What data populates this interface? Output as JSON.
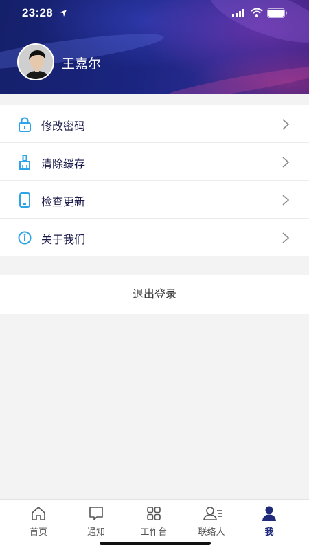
{
  "status_bar": {
    "time": "23:28"
  },
  "profile": {
    "name": "王嘉尔"
  },
  "menu": {
    "items": [
      {
        "label": "修改密码",
        "icon": "lock-icon"
      },
      {
        "label": "清除缓存",
        "icon": "brush-icon"
      },
      {
        "label": "检查更新",
        "icon": "phone-icon"
      },
      {
        "label": "关于我们",
        "icon": "info-icon"
      }
    ]
  },
  "logout": {
    "label": "退出登录"
  },
  "tabbar": {
    "tabs": [
      {
        "label": "首页",
        "icon": "home-icon"
      },
      {
        "label": "通知",
        "icon": "message-icon"
      },
      {
        "label": "工作台",
        "icon": "grid-icon"
      },
      {
        "label": "联络人",
        "icon": "contacts-icon"
      },
      {
        "label": "我",
        "icon": "person-icon",
        "active": true
      }
    ]
  },
  "colors": {
    "accent": "#1f2a7a",
    "icon_blue": "#2ea3e8",
    "background": "#f3f3f3"
  }
}
